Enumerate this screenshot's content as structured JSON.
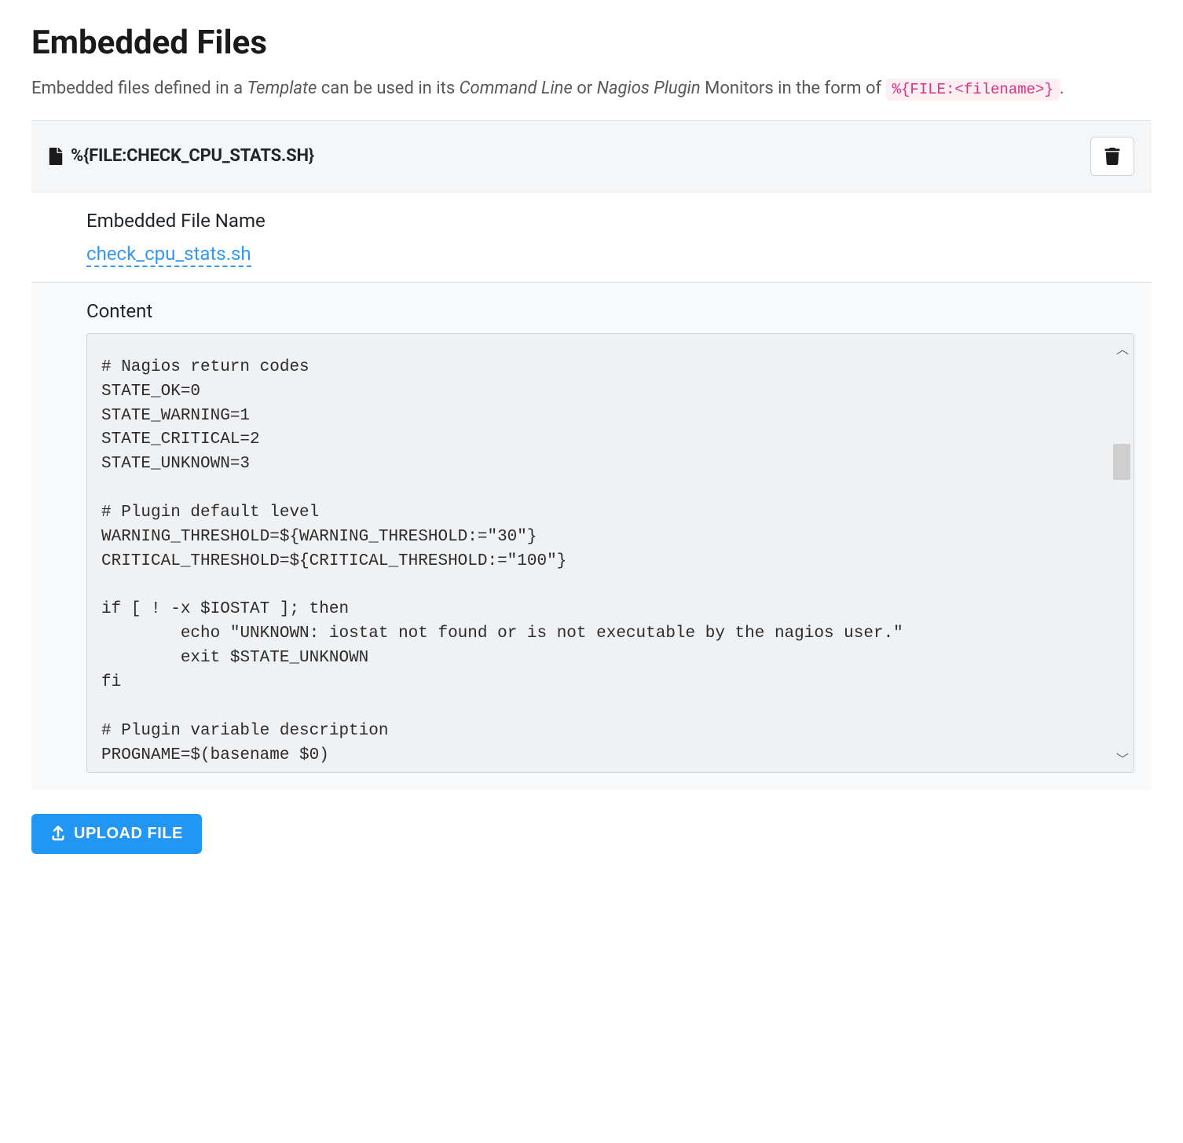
{
  "header": {
    "title": "Embedded Files",
    "desc_parts": {
      "p1": "Embedded files defined in a ",
      "em1": "Template",
      "p2": " can be used in its ",
      "em2": "Command Line",
      "p3": " or ",
      "em3": "Nagios Plugin",
      "p4": " Monitors in the form of ",
      "code": "%{FILE:<filename>}",
      "p5": "."
    }
  },
  "file": {
    "macro": "%{FILE:CHECK_CPU_STATS.SH}",
    "name_label": "Embedded File Name",
    "name_value": "check_cpu_stats.sh",
    "content_label": "Content",
    "content": "# Nagios return codes\nSTATE_OK=0\nSTATE_WARNING=1\nSTATE_CRITICAL=2\nSTATE_UNKNOWN=3\n\n# Plugin default level\nWARNING_THRESHOLD=${WARNING_THRESHOLD:=\"30\"}\nCRITICAL_THRESHOLD=${CRITICAL_THRESHOLD:=\"100\"}\n\nif [ ! -x $IOSTAT ]; then\n        echo \"UNKNOWN: iostat not found or is not executable by the nagios user.\"\n        exit $STATE_UNKNOWN\nfi\n\n# Plugin variable description\nPROGNAME=$(basename $0)"
  },
  "actions": {
    "upload": "UPLOAD FILE"
  }
}
